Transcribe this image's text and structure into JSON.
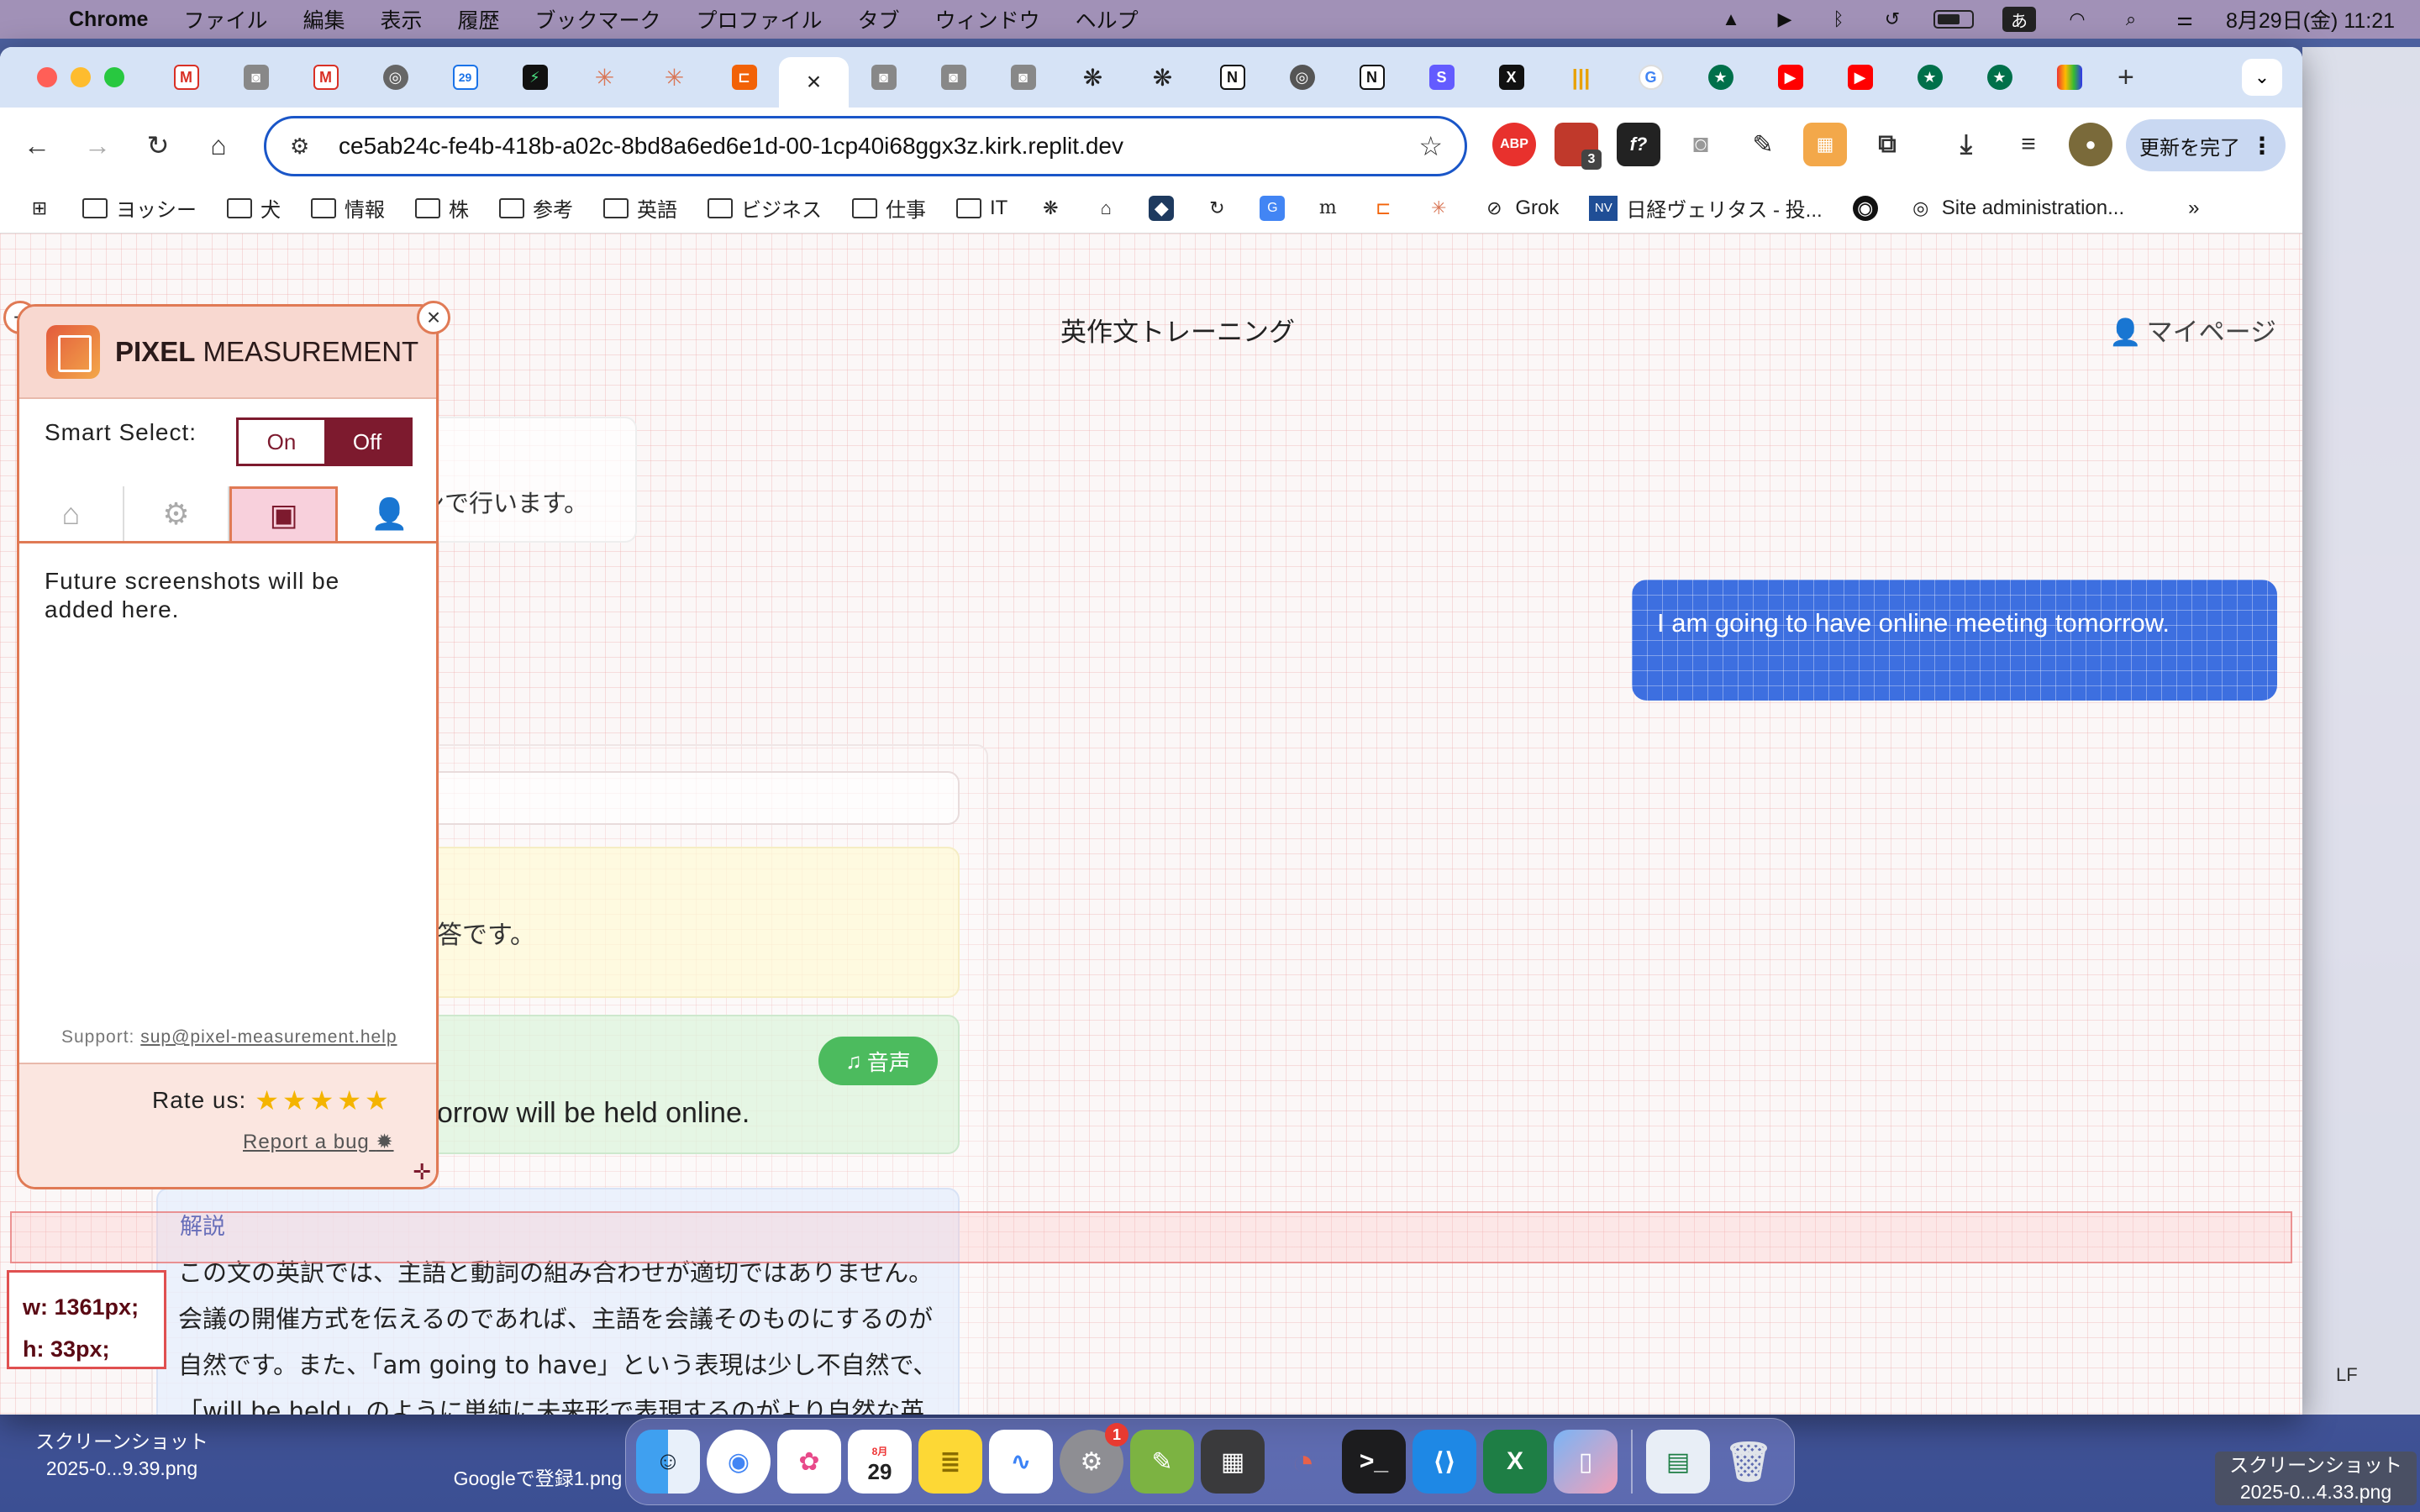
{
  "menubar": {
    "app_name": "Chrome",
    "items": [
      "ファイル",
      "編集",
      "表示",
      "履歴",
      "ブックマーク",
      "プロファイル",
      "タブ",
      "ウィンドウ",
      "ヘルプ"
    ],
    "ime": "あ",
    "datetime": "8月29日(金)  11:21"
  },
  "browser": {
    "tab_close": "×",
    "new_tab": "+",
    "url": "ce5ab24c-fe4b-418b-a02c-8bd8a6ed6e1d-00-1cp40i68ggx3z.kirk.replit.dev",
    "update_button": "更新を完了",
    "ext_abp": "ABP",
    "ext_badge": "3",
    "bookmarks": [
      "ヨッシー",
      "犬",
      "情報",
      "株",
      "参考",
      "英語",
      "ビジネス",
      "仕事",
      "IT",
      "Grok",
      "日経ヴェリタス - 投...",
      "Site administration..."
    ],
    "bookmark_nv": "NV",
    "more": "»"
  },
  "page": {
    "app_title": "英作文トレーニング",
    "mypage": "マイページ",
    "intro_fragment": "ンで行います。",
    "user_message": "I am going to have online meeting tomorrow.",
    "model_answer_fragment": "答です。",
    "audio_button": "音声",
    "corrected_fragment": "orrow will be held online.",
    "explain_label": "解説",
    "explain_body": "この文の英訳では、主語と動詞の組み合わせが適切ではありません。会議の開催方式を伝えるのであれば、主語を会議そのものにするのが自然です。また、「am going to have」という表現は少し不自然で、「will be held」のように単純に未来形で表現するのがより自然な英語表現になります。これらの点を改善"
  },
  "measurement": {
    "width_text": "w: 1361px;",
    "height_text": "h: 33px;"
  },
  "pixel_panel": {
    "title_bold": "PIXEL",
    "title_rest": "MEASUREMENT",
    "smart_select_label": "Smart Select:",
    "on_label": "On",
    "off_label": "Off",
    "message": "Future screenshots will be added here.",
    "support_label": "Support:",
    "support_email": "sup@pixel-measurement.help",
    "rate_label": "Rate us:",
    "stars": "★★★★★",
    "rating": 5,
    "report_bug": "Report a bug"
  },
  "dock": {
    "calendar_month": "8月",
    "calendar_day": "29",
    "settings_badge": "1"
  },
  "desktop": {
    "file_left": "スクリーンショット\n2025-0...9.39.png",
    "file_mid": "Googleで登録1.png",
    "file_right": "スクリーンショット\n2025-0...4.33.png",
    "status_lf": "LF"
  },
  "colors": {
    "accent_blue": "#3d6fe0",
    "panel_burgundy": "#7d1a2e",
    "panel_orange": "#e07a55",
    "audio_green": "#4cbb5e"
  }
}
